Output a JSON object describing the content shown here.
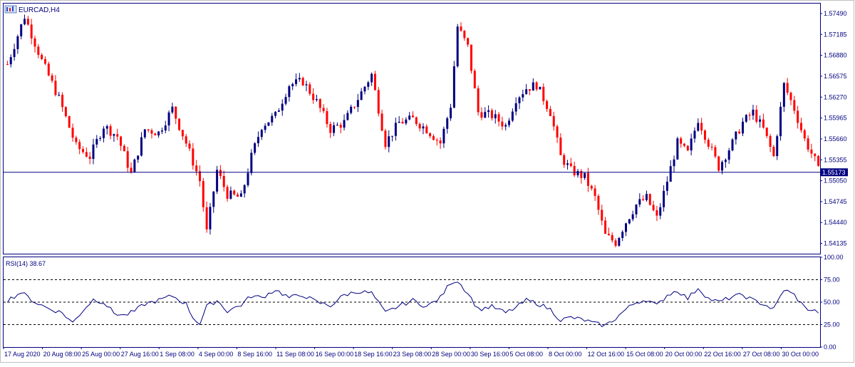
{
  "window": {
    "symbol_label": "EURCAD,H4",
    "icon": "mt-chart-window-icon"
  },
  "colors": {
    "background": "#ffffff",
    "frame": "#000080",
    "bull": "#000080",
    "bear": "#ff0000",
    "text": "#000080",
    "price_tag_bg": "#000080",
    "price_tag_text": "#ffffff"
  },
  "chart_data": [
    {
      "type": "candlestick",
      "title": "EURCAD,H4",
      "price_axis_ticks": [
        "1.57490",
        "1.57185",
        "1.56880",
        "1.56575",
        "1.56270",
        "1.55965",
        "1.55660",
        "1.55355",
        "1.55050",
        "1.54745",
        "1.54440",
        "1.54135"
      ],
      "ylim": [
        1.53985,
        1.57635
      ],
      "current_price": 1.55173,
      "current_price_label": "1.55173",
      "time_axis_labels": [
        "17 Aug 2020",
        "20 Aug 08:00",
        "25 Aug 00:00",
        "27 Aug 16:00",
        "1 Sep 08:00",
        "4 Sep 00:00",
        "8 Sep 16:00",
        "11 Sep 08:00",
        "16 Sep 00:00",
        "18 Sep 16:00",
        "23 Sep 08:00",
        "28 Sep 00:00",
        "30 Sep 16:00",
        "5 Oct 08:00",
        "8 Oct 00:00",
        "12 Oct 16:00",
        "15 Oct 08:00",
        "20 Oct 00:00",
        "22 Oct 16:00",
        "27 Oct 08:00",
        "30 Oct 00:00"
      ],
      "close_path": [
        [
          0,
          1.5675
        ],
        [
          5,
          1.5745
        ],
        [
          10,
          1.568
        ],
        [
          15,
          1.5625
        ],
        [
          20,
          1.5555
        ],
        [
          24,
          1.554
        ],
        [
          28,
          1.5585
        ],
        [
          32,
          1.557
        ],
        [
          36,
          1.5515
        ],
        [
          40,
          1.558
        ],
        [
          44,
          1.5575
        ],
        [
          48,
          1.561
        ],
        [
          52,
          1.556
        ],
        [
          56,
          1.5505
        ],
        [
          58,
          1.543
        ],
        [
          61,
          1.552
        ],
        [
          64,
          1.5485
        ],
        [
          68,
          1.548
        ],
        [
          71,
          1.554
        ],
        [
          74,
          1.5585
        ],
        [
          78,
          1.56
        ],
        [
          82,
          1.5645
        ],
        [
          86,
          1.565
        ],
        [
          90,
          1.562
        ],
        [
          94,
          1.558
        ],
        [
          98,
          1.559
        ],
        [
          102,
          1.5625
        ],
        [
          106,
          1.566
        ],
        [
          110,
          1.556
        ],
        [
          114,
          1.559
        ],
        [
          118,
          1.5595
        ],
        [
          122,
          1.558
        ],
        [
          126,
          1.556
        ],
        [
          129,
          1.5615
        ],
        [
          131,
          1.573
        ],
        [
          134,
          1.57
        ],
        [
          137,
          1.5605
        ],
        [
          141,
          1.56
        ],
        [
          145,
          1.5585
        ],
        [
          148,
          1.5625
        ],
        [
          151,
          1.564
        ],
        [
          154,
          1.5645
        ],
        [
          158,
          1.5605
        ],
        [
          161,
          1.554
        ],
        [
          164,
          1.552
        ],
        [
          168,
          1.551
        ],
        [
          171,
          1.548
        ],
        [
          174,
          1.5425
        ],
        [
          177,
          1.5415
        ],
        [
          180,
          1.5445
        ],
        [
          183,
          1.547
        ],
        [
          186,
          1.548
        ],
        [
          189,
          1.545
        ],
        [
          192,
          1.5505
        ],
        [
          195,
          1.556
        ],
        [
          198,
          1.5545
        ],
        [
          201,
          1.5595
        ],
        [
          204,
          1.556
        ],
        [
          207,
          1.5525
        ],
        [
          211,
          1.556
        ],
        [
          214,
          1.559
        ],
        [
          217,
          1.5605
        ],
        [
          220,
          1.558
        ],
        [
          223,
          1.554
        ],
        [
          226,
          1.5645
        ],
        [
          229,
          1.561
        ],
        [
          232,
          1.5565
        ],
        [
          235,
          1.5535
        ],
        [
          236,
          1.552
        ]
      ],
      "n_bars": 237
    },
    {
      "type": "line",
      "title": "RSI(14) 38.67",
      "indicator": "RSI(14)",
      "last_value": 38.67,
      "levels": [
        25,
        50,
        75
      ],
      "level_style": "dashed",
      "ylim": [
        0,
        100
      ],
      "y_ticks": [
        "100.00",
        "75.00",
        "50.00",
        "25.00",
        "0.00"
      ],
      "path": [
        [
          0,
          52
        ],
        [
          4,
          61
        ],
        [
          8,
          50
        ],
        [
          12,
          43
        ],
        [
          16,
          38
        ],
        [
          19,
          27
        ],
        [
          22,
          41
        ],
        [
          25,
          53
        ],
        [
          28,
          50
        ],
        [
          31,
          38
        ],
        [
          34,
          35
        ],
        [
          37,
          40
        ],
        [
          40,
          48
        ],
        [
          44,
          52
        ],
        [
          48,
          57
        ],
        [
          52,
          48
        ],
        [
          54,
          33
        ],
        [
          56,
          26
        ],
        [
          58,
          45
        ],
        [
          61,
          52
        ],
        [
          64,
          40
        ],
        [
          68,
          47
        ],
        [
          71,
          57
        ],
        [
          74,
          55
        ],
        [
          78,
          64
        ],
        [
          82,
          55
        ],
        [
          86,
          58
        ],
        [
          90,
          50
        ],
        [
          94,
          46
        ],
        [
          98,
          58
        ],
        [
          102,
          62
        ],
        [
          106,
          60
        ],
        [
          110,
          38
        ],
        [
          114,
          46
        ],
        [
          118,
          52
        ],
        [
          122,
          45
        ],
        [
          126,
          55
        ],
        [
          129,
          72
        ],
        [
          131,
          74
        ],
        [
          134,
          60
        ],
        [
          137,
          42
        ],
        [
          141,
          45
        ],
        [
          145,
          38
        ],
        [
          148,
          44
        ],
        [
          151,
          52
        ],
        [
          154,
          49
        ],
        [
          158,
          42
        ],
        [
          161,
          30
        ],
        [
          164,
          33
        ],
        [
          168,
          30
        ],
        [
          171,
          26
        ],
        [
          174,
          24
        ],
        [
          177,
          32
        ],
        [
          180,
          42
        ],
        [
          183,
          50
        ],
        [
          186,
          53
        ],
        [
          189,
          46
        ],
        [
          192,
          58
        ],
        [
          195,
          63
        ],
        [
          198,
          54
        ],
        [
          201,
          66
        ],
        [
          204,
          54
        ],
        [
          207,
          50
        ],
        [
          211,
          56
        ],
        [
          214,
          58
        ],
        [
          217,
          52
        ],
        [
          220,
          48
        ],
        [
          223,
          42
        ],
        [
          226,
          64
        ],
        [
          229,
          58
        ],
        [
          232,
          44
        ],
        [
          235,
          40
        ],
        [
          236,
          39
        ]
      ]
    }
  ]
}
